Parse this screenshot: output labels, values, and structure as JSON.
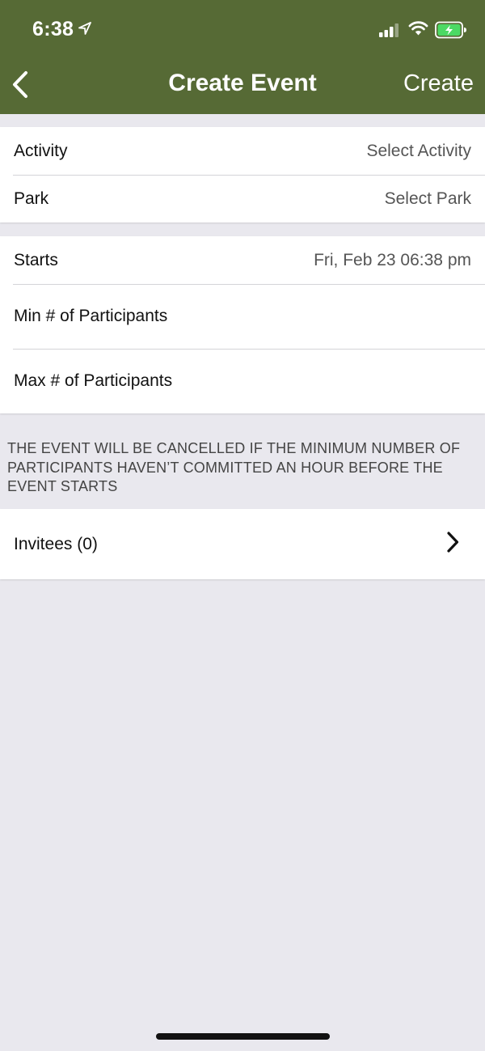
{
  "status_bar": {
    "time": "6:38"
  },
  "nav": {
    "title": "Create Event",
    "action_label": "Create"
  },
  "form": {
    "activity": {
      "label": "Activity",
      "value": "Select Activity"
    },
    "park": {
      "label": "Park",
      "value": "Select Park"
    },
    "starts": {
      "label": "Starts",
      "value": "Fri, Feb 23 06:38 pm"
    },
    "min_participants": {
      "label": "Min # of Participants"
    },
    "max_participants": {
      "label": "Max # of Participants"
    }
  },
  "footnote": "THE EVENT WILL BE CANCELLED IF THE MINIMUM NUMBER OF PARTICIPANTS HAVEN’T COMMITTED AN HOUR BEFORE THE EVENT STARTS",
  "invitees": {
    "label": "Invitees (0)"
  },
  "colors": {
    "header": "#566a35",
    "background": "#e9e8ee",
    "battery": "#4cd964"
  },
  "icons": {
    "back": "chevron-left-icon",
    "location": "location-arrow-icon",
    "signal": "cellular-signal-icon",
    "wifi": "wifi-icon",
    "battery": "battery-charging-icon",
    "disclosure": "chevron-right-icon"
  }
}
